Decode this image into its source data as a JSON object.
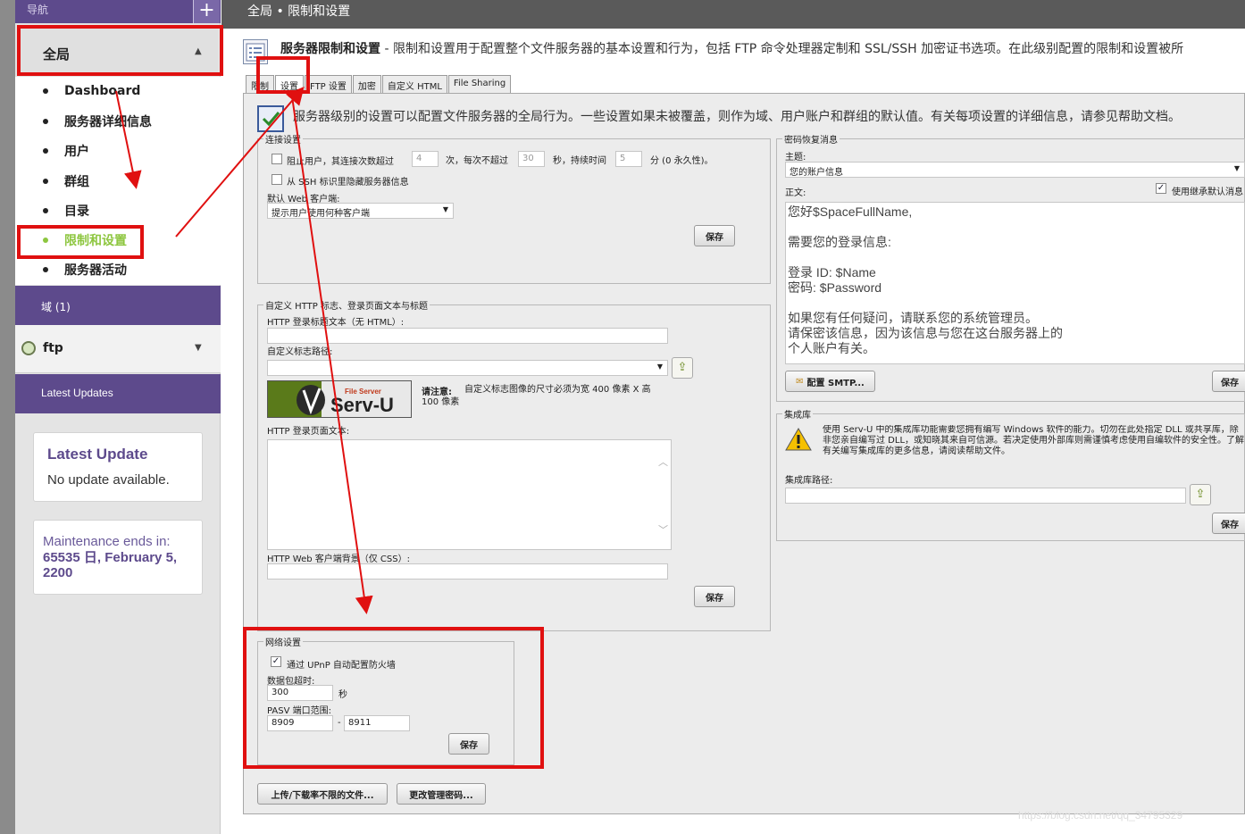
{
  "nav": {
    "header_label": "导航",
    "plus": "+"
  },
  "sidebar": {
    "global_label": "全局",
    "items": [
      {
        "label": "Dashboard"
      },
      {
        "label": "服务器详细信息"
      },
      {
        "label": "用户"
      },
      {
        "label": "群组"
      },
      {
        "label": "目录"
      },
      {
        "label": "限制和设置"
      },
      {
        "label": "服务器活动"
      }
    ],
    "domain_label": "域 (1)",
    "ftp_label": "ftp",
    "updates_label": "Latest Updates",
    "update_card": {
      "title": "Latest Update",
      "text": "No update available."
    },
    "maintenance": {
      "label": "Maintenance ends in:",
      "value": "65535 日, February 5, 2200"
    }
  },
  "header": {
    "breadcrumb": "全局 • 限制和设置"
  },
  "page": {
    "title": "服务器限制和设置",
    "description": " - 限制和设置用于配置整个文件服务器的基本设置和行为，包括 FTP 命令处理器定制和 SSL/SSH 加密证书选项。在此级别配置的限制和设置被所",
    "info": "服务器级别的设置可以配置文件服务器的全局行为。一些设置如果未被覆盖，则作为域、用户账户和群组的默认值。有关每项设置的详细信息，请参见帮助文档。"
  },
  "tabs": [
    "限制",
    "设置",
    "FTP 设置",
    "加密",
    "自定义 HTML",
    "File Sharing"
  ],
  "connection": {
    "legend": "连接设置",
    "block_label_a": "阻止用户，其连接次数超过",
    "block_count": "4",
    "block_label_b": "次，每次不超过",
    "block_seconds": "30",
    "block_label_c": "秒，持续时间",
    "block_minutes": "5",
    "block_label_d": "分 (0 永久性)。",
    "hide_ssh_label": "从 SSH 标识里隐藏服务器信息",
    "web_client_label": "默认 Web 客户端:",
    "web_client_value": "提示用户使用何种客户端",
    "save": "保存"
  },
  "custom_http": {
    "legend": "自定义 HTTP 标志、登录页面文本与标题",
    "login_title_label": "HTTP 登录标题文本（无 HTML）:",
    "logo_path_label": "自定义标志路径:",
    "logo_brand": "Serv-U",
    "logo_sub": "File Server",
    "note_bold": "请注意:",
    "note_text": "自定义标志图像的尺寸必须为宽 400 像素 X 高 100 像素",
    "login_text_label": "HTTP 登录页面文本:",
    "bg_label": "HTTP Web 客户端背景（仅 CSS）:",
    "save": "保存"
  },
  "network": {
    "legend": "网络设置",
    "upnp_label": "通过 UPnP 自动配置防火墙",
    "timeout_label": "数据包超时:",
    "timeout_value": "300",
    "timeout_unit": "秒",
    "pasv_label": "PASV 端口范围:",
    "pasv_from": "8909",
    "pasv_dash": "-",
    "pasv_to": "8911",
    "save": "保存"
  },
  "bottom_buttons": {
    "unlimited_files": "上传/下载率不限的文件...",
    "change_password": "更改管理密码..."
  },
  "password_recovery": {
    "legend": "密码恢复消息",
    "subject_label": "主题:",
    "subject_value": "您的账户信息",
    "body_label": "正文:",
    "inherit_label": "使用继承默认消息",
    "body_lines": [
      "您好$SpaceFullName,",
      "",
      "需要您的登录信息:",
      "",
      "登录 ID:   $Name",
      "密码:      $Password",
      "",
      "如果您有任何疑问，请联系您的系统管理员。",
      "请保密该信息，因为该信息与您在这台服务器上的",
      "个人账户有关。"
    ],
    "smtp_button": "配置 SMTP...",
    "save": "保存"
  },
  "integration": {
    "legend": "集成库",
    "warning": "使用 Serv-U 中的集成库功能需要您拥有编写 Windows 软件的能力。切勿在此处指定 DLL 或共享库，除非您亲自编写过 DLL，或知晓其来自可信源。若决定使用外部库则需谨慎考虑使用自编软件的安全性。了解有关编写集成库的更多信息，请阅读帮助文件。",
    "path_label": "集成库路径:",
    "save": "保存"
  },
  "watermark": "https://blog.csdn.net/qq_34795329"
}
